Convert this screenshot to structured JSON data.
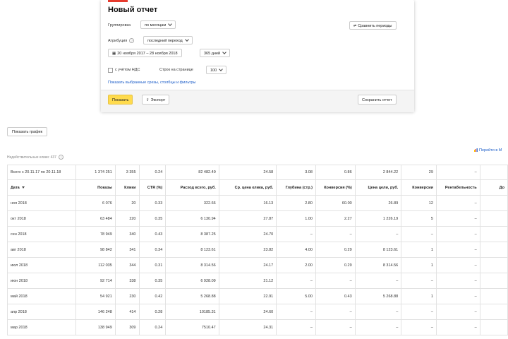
{
  "report": {
    "title": "Новый отчет",
    "grouping_label": "Группировка",
    "grouping_value": "по месяцам",
    "attribution_label": "Атрибуция",
    "attribution_value": "последний переход",
    "date_range": "20 ноября 2017 – 28 ноября 2018",
    "days": "365 дней",
    "vat_label": "с учётом НДС",
    "rows_label": "Строк на странице",
    "rows_value": "100",
    "compare_label": "Сравнить периоды",
    "selected_link": "Показать выбранные срезы, столбцы и фильтры",
    "show_label": "Показать",
    "export_label": "Экспорт",
    "save_label": "Сохранить отчет"
  },
  "graph_button": "Показать график",
  "invalid_clicks": "Недействительные клики: 437",
  "goto_link": "Перейти в М",
  "table": {
    "columns": [
      "Дата",
      "Показы",
      "Клики",
      "CTR (%)",
      "Расход всего, руб.",
      "Ср. цена клика, руб.",
      "Глубина (стр.)",
      "Конверсия (%)",
      "Цена цели, руб.",
      "Конверсии",
      "Рентабельность",
      "До"
    ],
    "total": [
      "Всего с 20.11.17 по 20.11.18",
      "1 374 251",
      "3 355",
      "0.24",
      "82 482.49",
      "24.58",
      "3.08",
      "0.86",
      "2 844.22",
      "29",
      "–",
      ""
    ],
    "rows": [
      [
        "ноя 2018",
        "6 076",
        "20",
        "0.33",
        "322.66",
        "16.13",
        "2.80",
        "60.00",
        "26.89",
        "12",
        "–",
        ""
      ],
      [
        "окт 2018",
        "63 484",
        "220",
        "0.35",
        "6 130.94",
        "27.87",
        "1.00",
        "2.27",
        "1 226.19",
        "5",
        "–",
        ""
      ],
      [
        "сен 2018",
        "78 949",
        "340",
        "0.43",
        "8 387.25",
        "24.70",
        "–",
        "–",
        "–",
        "–",
        "–",
        ""
      ],
      [
        "авг 2018",
        "98 842",
        "341",
        "0.34",
        "8 123.61",
        "23.82",
        "4.00",
        "0.29",
        "8 123.61",
        "1",
        "–",
        ""
      ],
      [
        "июл 2018",
        "112 035",
        "344",
        "0.31",
        "8 314.56",
        "24.17",
        "2.00",
        "0.29",
        "8 314.56",
        "1",
        "–",
        ""
      ],
      [
        "июн 2018",
        "92 714",
        "338",
        "0.35",
        "6 928.09",
        "21.12",
        "–",
        "–",
        "–",
        "–",
        "–",
        ""
      ],
      [
        "май 2018",
        "54 921",
        "230",
        "0.42",
        "5 268.88",
        "22.91",
        "5.00",
        "0.43",
        "5 268.88",
        "1",
        "–",
        ""
      ],
      [
        "апр 2018",
        "146 248",
        "414",
        "0.28",
        "10185.31",
        "24.60",
        "–",
        "–",
        "–",
        "–",
        "–",
        ""
      ],
      [
        "мар 2018",
        "138 949",
        "309",
        "0.24",
        "7510.47",
        "24.31",
        "–",
        "–",
        "–",
        "–",
        "–",
        ""
      ]
    ]
  }
}
